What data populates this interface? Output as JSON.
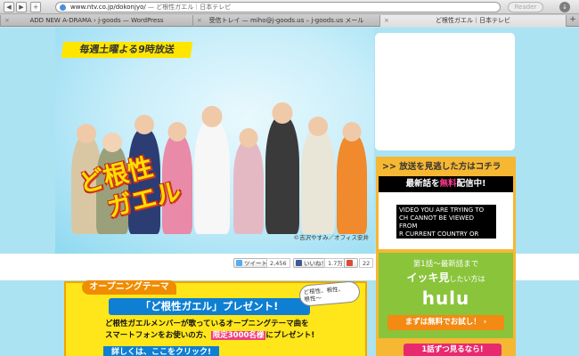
{
  "browser": {
    "url": "www.ntv.co.jp/dokonjyo/",
    "page_title": "ど根性ガエル｜日本テレビ",
    "reader": "Reader",
    "tabs": [
      {
        "label": "ADD NEW A-DRAMA › j-goods — WordPress",
        "active": false
      },
      {
        "label": "受信トレイ — miho@j-goods.us – j-goods.us メール",
        "active": false
      },
      {
        "label": "ど根性ガエル｜日本テレビ",
        "active": true
      }
    ]
  },
  "hero": {
    "weekly": "毎週土曜よる9時放送",
    "logo_line1": "ど根性",
    "logo_line2": "ガエル",
    "copyright": "©吉沢やすみ／オフィス安井"
  },
  "social": {
    "tweet": "ツイート",
    "tweet_count": "2,456",
    "like": "いいね！",
    "like_count": "1.7万",
    "plus_count": "22"
  },
  "sidebar": {
    "title": ">> 放送を見逃した方はコチラ",
    "latest_prefix": "最新話を",
    "latest_free": "無料",
    "latest_suffix": "配信中!",
    "video_notice": "VIDEO YOU ARE TRYING TO\nCH CANNOT BE VIEWED FROM\nR CURRENT COUNTRY OR\nATION.",
    "line1": "第1話～最新話まで",
    "line2_big": "イッキ見",
    "line2_small": "したい方は",
    "hulu": "hulu",
    "trial": "まずは無料でお試し！ ›",
    "one_by_one": "1話ずつ見るなら!"
  },
  "opening": {
    "head": "オープニングテーマ",
    "present": "「ど根性ガエル」プレゼント!",
    "bubble": "ど根性、根性、\n根性～",
    "body_line1": "ど根性ガエルメンバーが歌っているオープニングテーマ曲を",
    "body_line2_pre": "スマートフォンをお使いの方、",
    "body_highlight": "限定3000名様",
    "body_line2_post": "にプレゼント!",
    "click": "詳しくは、ここをクリック!"
  },
  "colors": {
    "accent_yellow": "#ffe600",
    "sidebar_orange": "#f6b733",
    "hulu_green": "#8ac43b",
    "pink": "#e72a6f",
    "blue": "#0e7fd3"
  }
}
